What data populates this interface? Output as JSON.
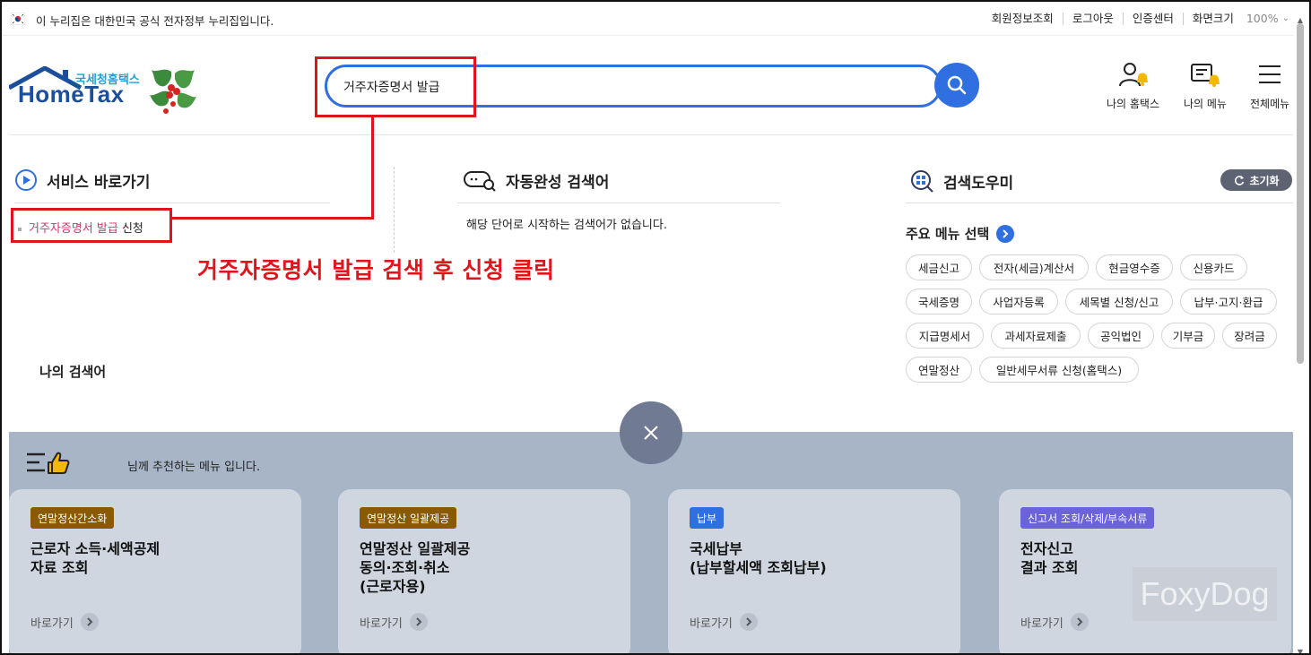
{
  "gov_bar": {
    "text": "이 누리집은 대한민국 공식 전자정부 누리집입니다.",
    "links": [
      "회원정보조회",
      "로그아웃",
      "인증센터",
      "화면크기"
    ],
    "zoom": "100%"
  },
  "logo": {
    "sub": "국세청홈택스",
    "main": "HomeTax"
  },
  "search": {
    "value": "거주자증명서 발급"
  },
  "header_icons": [
    {
      "label": "나의 홈택스"
    },
    {
      "label": "나의 메뉴"
    },
    {
      "label": "전체메뉴"
    }
  ],
  "service_shortcut": {
    "title": "서비스 바로가기",
    "item_highlight": "거주자증명서 발급",
    "item_suffix": " 신청"
  },
  "autocomplete": {
    "title": "자동완성 검색어",
    "message": "해당 단어로 시작하는 검색어가 없습니다."
  },
  "my_search": {
    "title": "나의 검색어"
  },
  "search_helper": {
    "title": "검색도우미",
    "reset": "초기화",
    "main_menu_label": "주요 메뉴 선택",
    "chips": [
      "세금신고",
      "전자(세금)계산서",
      "현금영수증",
      "신용카드",
      "국세증명",
      "사업자등록",
      "세목별 신청/신고",
      "납부·고지·환급",
      "지급명세서",
      "과세자료제출",
      "공익법인",
      "기부금",
      "장려금",
      "연말정산",
      "일반세무서류 신청(홈택스)"
    ]
  },
  "annotation": {
    "text": "거주자증명서 발급 검색 후 신청 클릭"
  },
  "recommend": {
    "header": "님께 추천하는 메뉴 입니다.",
    "cards": [
      {
        "badge": "연말정산간소화",
        "badge_color": "#8a5a00",
        "title": "근로자 소득·세액공제\n자료 조회",
        "go": "바로가기"
      },
      {
        "badge": "연말정산 일괄제공",
        "badge_color": "#8a5a00",
        "title": "연말정산 일괄제공\n동의·조회·취소\n(근로자용)",
        "go": "바로가기"
      },
      {
        "badge": "납부",
        "badge_color": "#2f6fe0",
        "title": "국세납부\n(납부할세액 조회납부)",
        "go": "바로가기"
      },
      {
        "badge": "신고서 조회/삭제/부속서류",
        "badge_color": "#6b63d9",
        "title": "전자신고\n결과 조회",
        "go": "바로가기"
      }
    ]
  },
  "watermark": "FoxyDog",
  "icons": [
    "flag-icon",
    "search-icon",
    "user-bell-icon",
    "menu-bell-icon",
    "hamburger-icon",
    "play-icon",
    "keyboard-search-icon",
    "grid-search-icon",
    "refresh-icon",
    "chevron-right-icon",
    "close-icon",
    "thumbs-up-list-icon"
  ]
}
